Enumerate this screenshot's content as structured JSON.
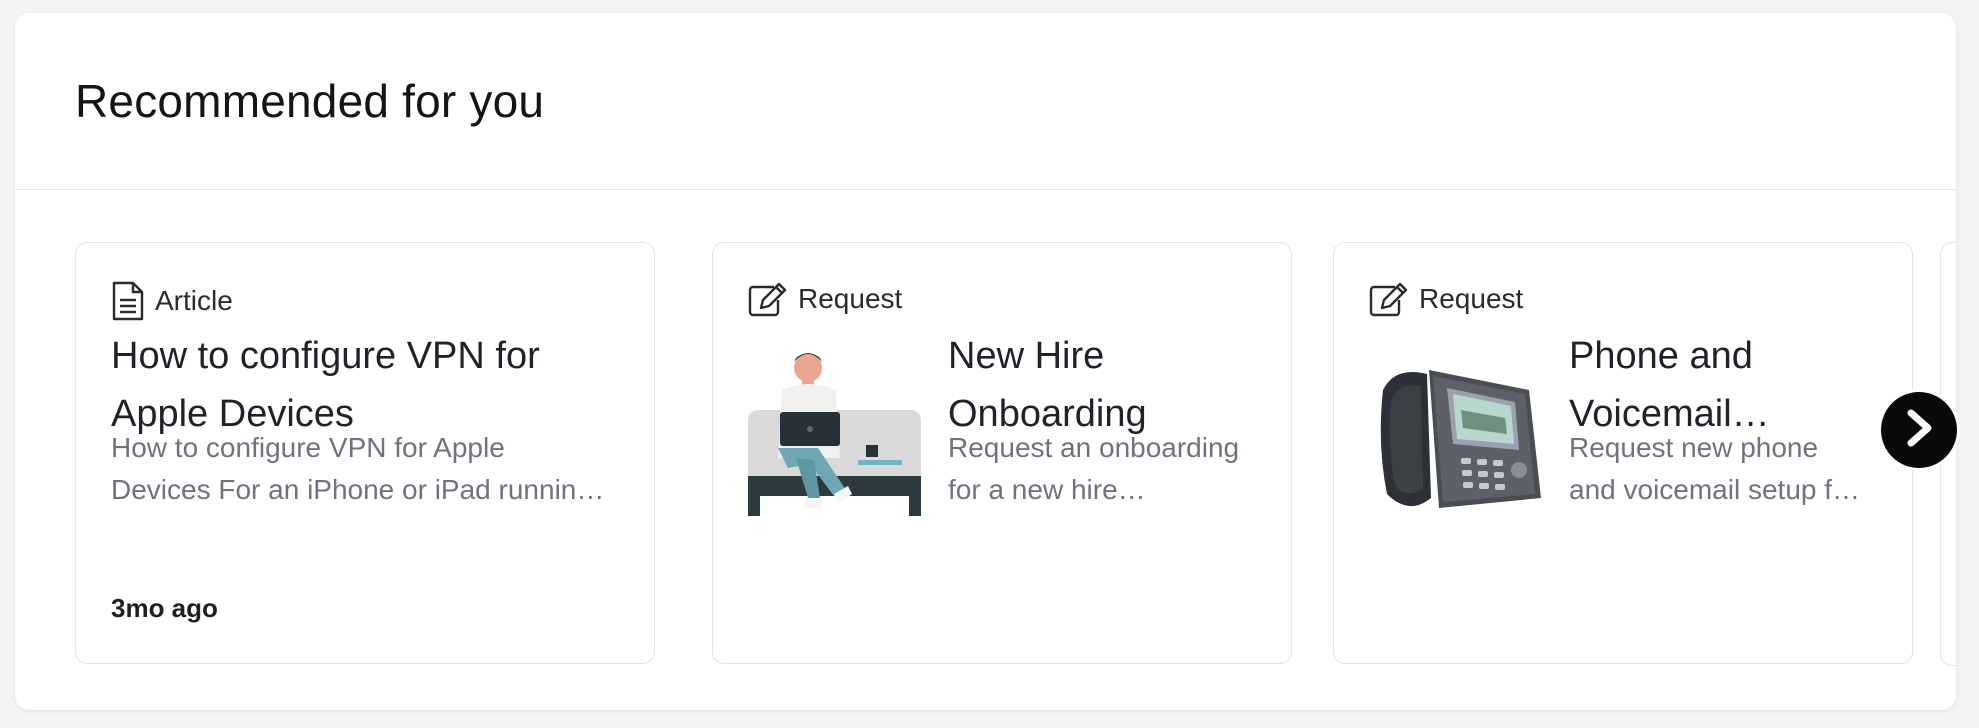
{
  "section": {
    "title": "Recommended for you"
  },
  "cards": [
    {
      "type_label": "Article",
      "type_icon": "document-icon",
      "title": "How to configure VPN for Apple Devices",
      "description_line1": "How to configure VPN for Apple",
      "description_line2": "Devices For an iPhone or iPad runnin…",
      "meta": "3mo ago"
    },
    {
      "type_label": "Request",
      "type_icon": "edit-form-icon",
      "title_line1": "New Hire",
      "title_line2": "Onboarding",
      "description_line1": "Request an onboarding",
      "description_line2": "for a new hire…",
      "thumbnail": "person-with-laptop-illustration"
    },
    {
      "type_label": "Request",
      "type_icon": "edit-form-icon",
      "title_line1": "Phone and",
      "title_line2": "Voicemail…",
      "description_line1": "Request new phone",
      "description_line2": "and voicemail setup f…",
      "thumbnail": "desk-phone-image"
    }
  ],
  "carousel": {
    "next_icon": "chevron-right-icon"
  }
}
